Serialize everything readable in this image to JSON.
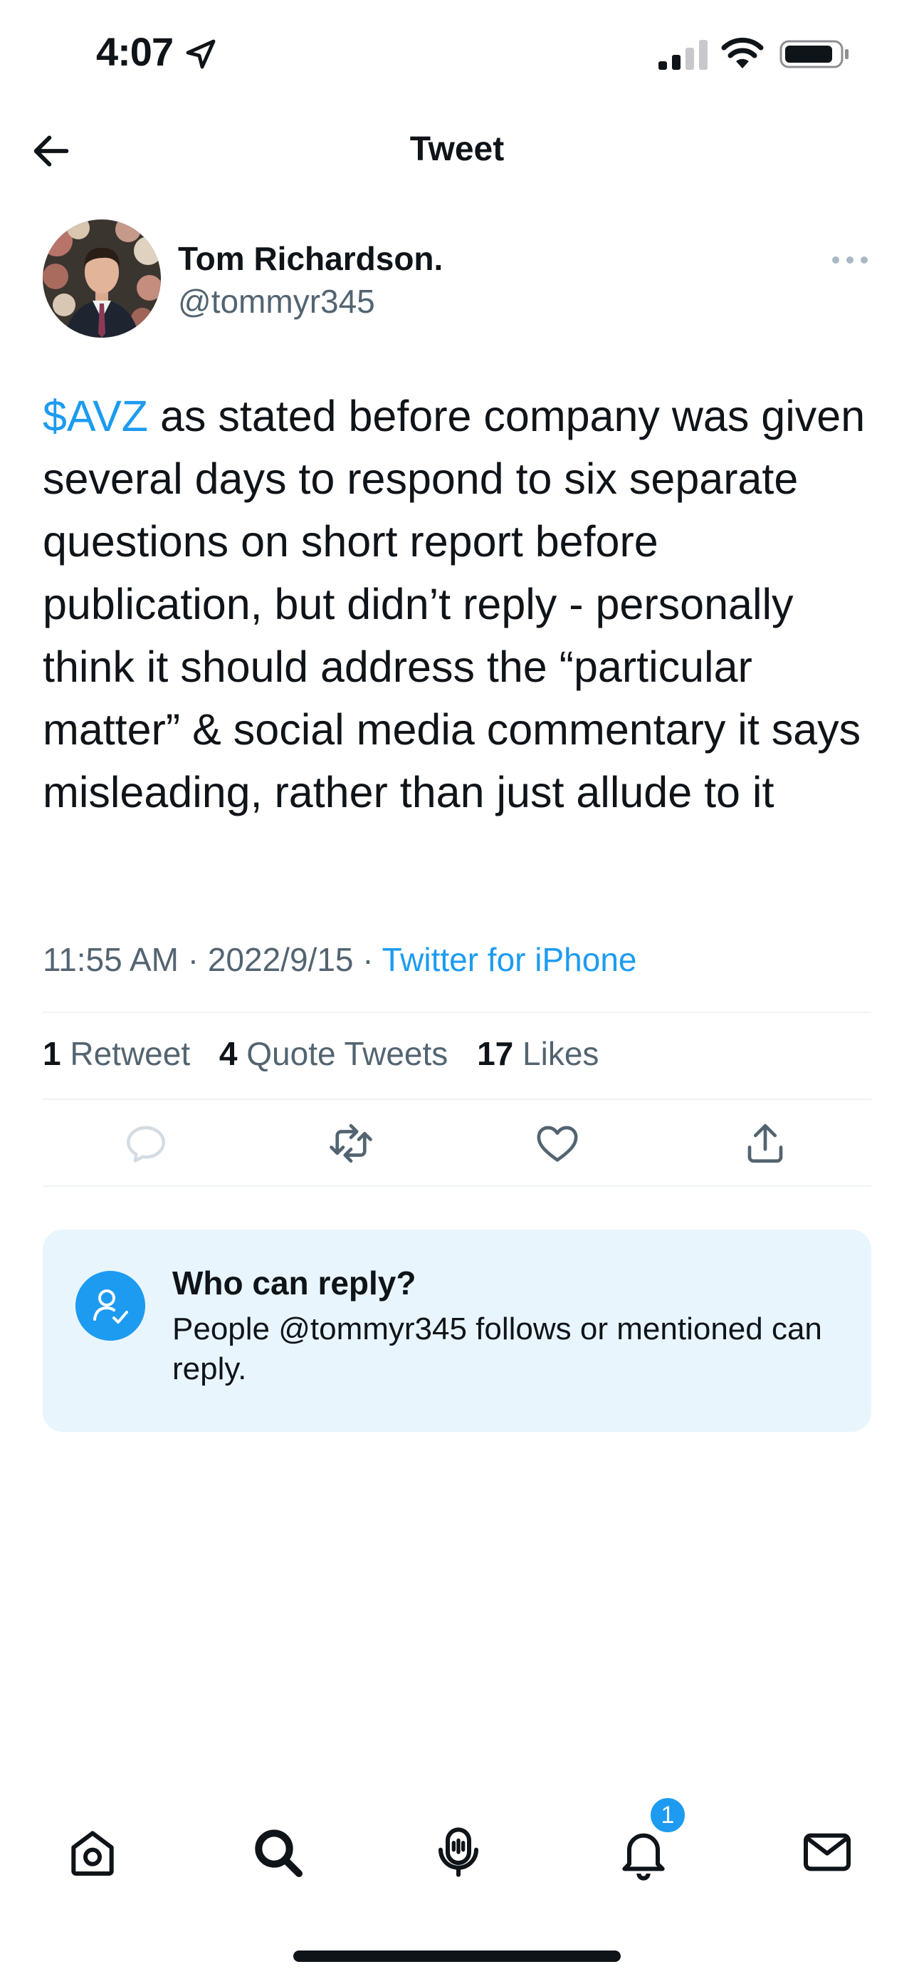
{
  "status_bar": {
    "time": "4:07"
  },
  "header": {
    "title": "Tweet"
  },
  "author": {
    "name": "Tom Richardson.",
    "handle": "@tommyr345"
  },
  "tweet": {
    "cashtag": "$AVZ",
    "text": " as stated before company was given several days to respond to six separate questions on short report before publication, but didn’t reply - personally think it should address the “particular matter” & social media commentary it says misleading, rather than just allude to it",
    "time": "11:55 AM",
    "date": "2022/9/15",
    "separator": "·",
    "source": "Twitter for iPhone"
  },
  "stats": {
    "retweets_count": "1",
    "retweets_label": "Retweet",
    "quotes_count": "4",
    "quotes_label": "Quote Tweets",
    "likes_count": "17",
    "likes_label": "Likes"
  },
  "reply_card": {
    "title": "Who can reply?",
    "description": "People @tommyr345 follows or mentioned can reply."
  },
  "tab_bar": {
    "notifications_badge": "1",
    "items": [
      "home-icon",
      "search-icon",
      "spaces-icon",
      "notifications-icon",
      "messages-icon"
    ]
  },
  "colors": {
    "accent": "#1d9bf0",
    "secondary_text": "#536471",
    "reply_card_bg": "#e8f5fd"
  }
}
